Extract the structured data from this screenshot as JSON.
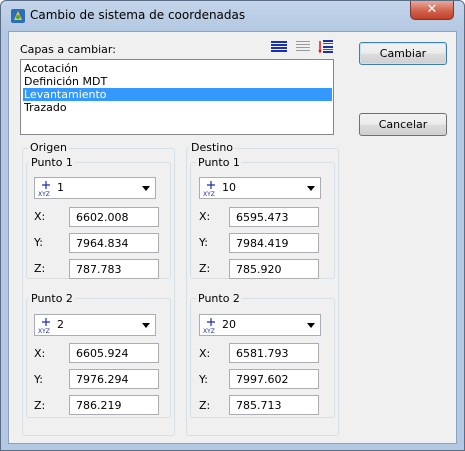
{
  "window": {
    "title": "Cambio de sistema de coordenadas",
    "close_glyph": "✕"
  },
  "layers": {
    "label": "Capas a cambiar:",
    "items": [
      {
        "label": "Acotación",
        "selected": false
      },
      {
        "label": "Definición MDT",
        "selected": false
      },
      {
        "label": "Levantamiento",
        "selected": true
      },
      {
        "label": "Trazado",
        "selected": false
      }
    ],
    "toolbar_icons": [
      "select-all-icon",
      "select-none-icon",
      "invert-selection-icon"
    ]
  },
  "buttons": {
    "cambiar": "Cambiar",
    "cancelar": "Cancelar"
  },
  "origen": {
    "label": "Origen",
    "punto1": {
      "label": "Punto 1",
      "point": "1",
      "x": "6602.008",
      "y": "7964.834",
      "z": "787.783"
    },
    "punto2": {
      "label": "Punto 2",
      "point": "2",
      "x": "6605.924",
      "y": "7976.294",
      "z": "786.219"
    }
  },
  "destino": {
    "label": "Destino",
    "punto1": {
      "label": "Punto 1",
      "point": "10",
      "x": "6595.473",
      "y": "7984.419",
      "z": "785.920"
    },
    "punto2": {
      "label": "Punto 2",
      "point": "20",
      "x": "6581.793",
      "y": "7997.602",
      "z": "785.713"
    }
  },
  "axis_labels": {
    "x": "X:",
    "y": "Y:",
    "z": "Z:"
  },
  "colors": {
    "selection": "#3399ff",
    "toolbar_icon": "#1c2fa8"
  }
}
